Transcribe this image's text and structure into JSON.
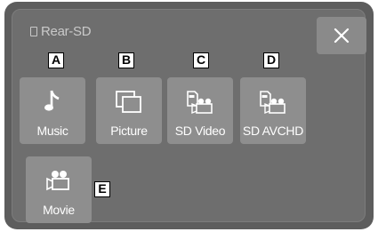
{
  "header": {
    "source_label": "Rear-SD",
    "source_icon": "sd-card-icon"
  },
  "close_icon": "close-icon",
  "tiles": [
    {
      "label": "Music",
      "icon": "music-note-icon",
      "callout": "A"
    },
    {
      "label": "Picture",
      "icon": "picture-icon",
      "callout": "B"
    },
    {
      "label": "SD Video",
      "icon": "sd-video-icon",
      "callout": "C"
    },
    {
      "label": "SD AVCHD",
      "icon": "sd-avchd-icon",
      "callout": "D"
    },
    {
      "label": "Movie",
      "icon": "movie-camera-icon",
      "callout": "E"
    }
  ],
  "colors": {
    "screen": "#5d5d5d",
    "panel": "#6e6e6e",
    "tile": "#8e8e8e",
    "text": "#ffffff"
  }
}
